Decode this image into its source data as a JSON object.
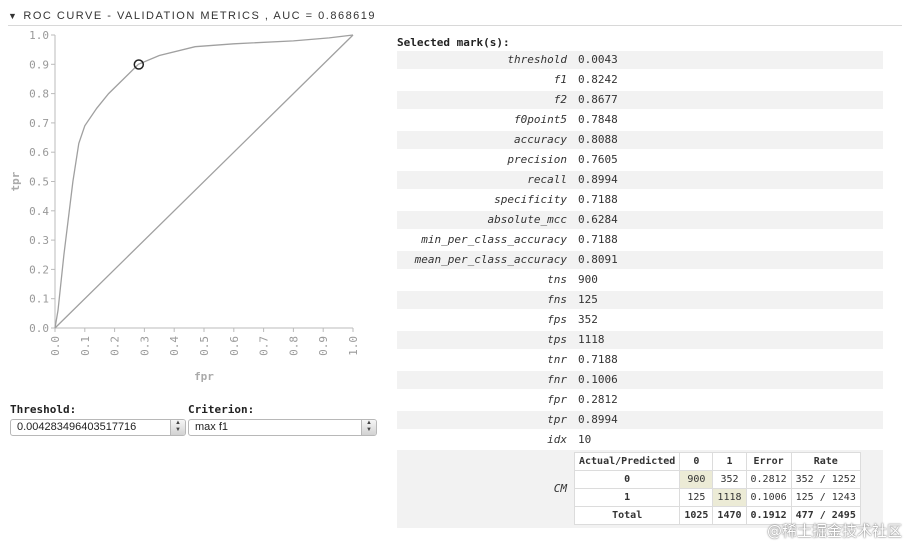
{
  "header": {
    "title": "ROC CURVE - VALIDATION METRICS , AUC = 0.868619"
  },
  "chart_data": {
    "type": "line",
    "xlabel": "fpr",
    "ylabel": "tpr",
    "xlim": [
      0,
      1
    ],
    "ylim": [
      0,
      1
    ],
    "xticks": [
      "0.0",
      "0.1",
      "0.2",
      "0.3",
      "0.4",
      "0.5",
      "0.6",
      "0.7",
      "0.8",
      "0.9",
      "1.0"
    ],
    "yticks": [
      "0.0",
      "0.1",
      "0.2",
      "0.3",
      "0.4",
      "0.5",
      "0.6",
      "0.7",
      "0.8",
      "0.9",
      "1.0"
    ],
    "series": [
      {
        "values": [
          [
            0,
            0
          ],
          [
            0.01,
            0.06
          ],
          [
            0.03,
            0.25
          ],
          [
            0.06,
            0.5
          ],
          [
            0.08,
            0.63
          ],
          [
            0.1,
            0.69
          ],
          [
            0.14,
            0.75
          ],
          [
            0.18,
            0.8
          ],
          [
            0.23,
            0.85
          ],
          [
            0.28,
            0.9
          ],
          [
            0.35,
            0.93
          ],
          [
            0.47,
            0.96
          ],
          [
            0.6,
            0.97
          ],
          [
            0.8,
            0.98
          ],
          [
            0.92,
            0.99
          ],
          [
            1,
            1
          ]
        ]
      },
      {
        "values": [
          [
            0,
            0
          ],
          [
            1,
            1
          ]
        ]
      }
    ],
    "selected_point": {
      "x": 0.2812,
      "y": 0.8994
    },
    "grid": false
  },
  "controls": {
    "threshold_label": "Threshold:",
    "threshold_value": "0.004283496403517716",
    "criterion_label": "Criterion:",
    "criterion_value": "max f1"
  },
  "metrics": {
    "title": "Selected mark(s):",
    "rows": [
      {
        "name": "threshold",
        "value": "0.0043"
      },
      {
        "name": "f1",
        "value": "0.8242"
      },
      {
        "name": "f2",
        "value": "0.8677"
      },
      {
        "name": "f0point5",
        "value": "0.7848"
      },
      {
        "name": "accuracy",
        "value": "0.8088"
      },
      {
        "name": "precision",
        "value": "0.7605"
      },
      {
        "name": "recall",
        "value": "0.8994"
      },
      {
        "name": "specificity",
        "value": "0.7188"
      },
      {
        "name": "absolute_mcc",
        "value": "0.6284"
      },
      {
        "name": "min_per_class_accuracy",
        "value": "0.7188"
      },
      {
        "name": "mean_per_class_accuracy",
        "value": "0.8091"
      },
      {
        "name": "tns",
        "value": "900"
      },
      {
        "name": "fns",
        "value": "125"
      },
      {
        "name": "fps",
        "value": "352"
      },
      {
        "name": "tps",
        "value": "1118"
      },
      {
        "name": "tnr",
        "value": "0.7188"
      },
      {
        "name": "fnr",
        "value": "0.1006"
      },
      {
        "name": "fpr",
        "value": "0.2812"
      },
      {
        "name": "tpr",
        "value": "0.8994"
      },
      {
        "name": "idx",
        "value": "10"
      }
    ],
    "cm": {
      "label": "CM",
      "headers": [
        "Actual/Predicted",
        "0",
        "1",
        "Error",
        "Rate"
      ],
      "rows": [
        [
          "0",
          "900",
          "352",
          "0.2812",
          "352 / 1252"
        ],
        [
          "1",
          "125",
          "1118",
          "0.1006",
          "125 / 1243"
        ],
        [
          "Total",
          "1025",
          "1470",
          "0.1912",
          "477 / 2495"
        ]
      ]
    }
  },
  "watermark": "@稀土掘金技术社区"
}
